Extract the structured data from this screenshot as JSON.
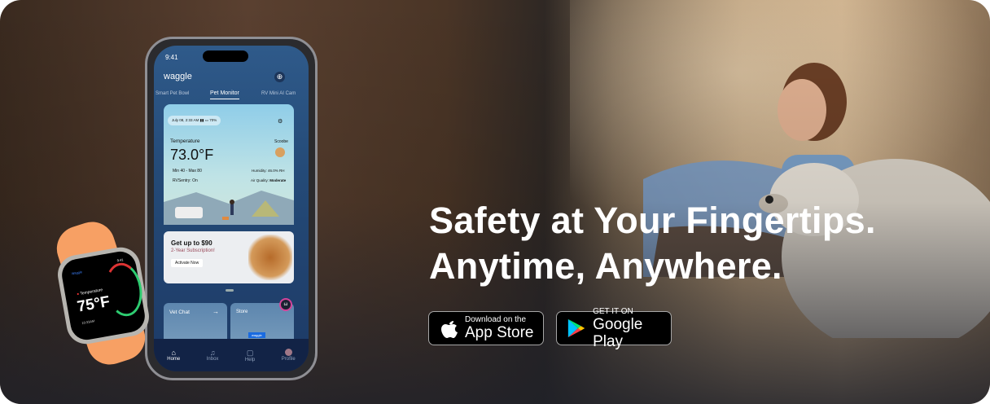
{
  "headline": {
    "line1": "Safety at Your Fingertips.",
    "line2": "Anytime, Anywhere."
  },
  "badges": {
    "appstore": {
      "small": "Download on the",
      "big": "App Store"
    },
    "googleplay": {
      "small": "GET IT ON",
      "big": "Google Play"
    }
  },
  "phone": {
    "time": "9:41",
    "logo": "waggle",
    "tabs": [
      "Smart Pet Bowl",
      "Pet Monitor",
      "RV Mini AI Cam"
    ],
    "active_tab": "Pet Monitor",
    "status_chip": "July 08, 2:33 AM",
    "battery": "70%",
    "temperature_label": "Temperature",
    "temperature": "73.0°F",
    "pet_name": "Scoobe",
    "min_max": "Min 40  -  Max 80",
    "humidity": "Humidity: 46.0% RH",
    "rvsentry": "RVSentry: On",
    "air_quality_label": "Air Quality:",
    "air_quality": "Moderate",
    "promo": {
      "title": "Get up to $90",
      "subtitle": "2-Year Subscription!",
      "button": "Activate Now"
    },
    "tiles": {
      "vet_chat": "Vet Chat",
      "store": "Store",
      "store_sign": "waggle"
    },
    "nav": [
      "Home",
      "Inbox",
      "Help",
      "Profile"
    ]
  },
  "watch": {
    "brand": "Waggle",
    "time": "9:41",
    "label": "Temperature",
    "value": "75°F",
    "updated": "10:33AM"
  },
  "colors": {
    "accent_orange": "#f7a064",
    "screen_blue": "#244a77",
    "badge_black": "#000000"
  }
}
